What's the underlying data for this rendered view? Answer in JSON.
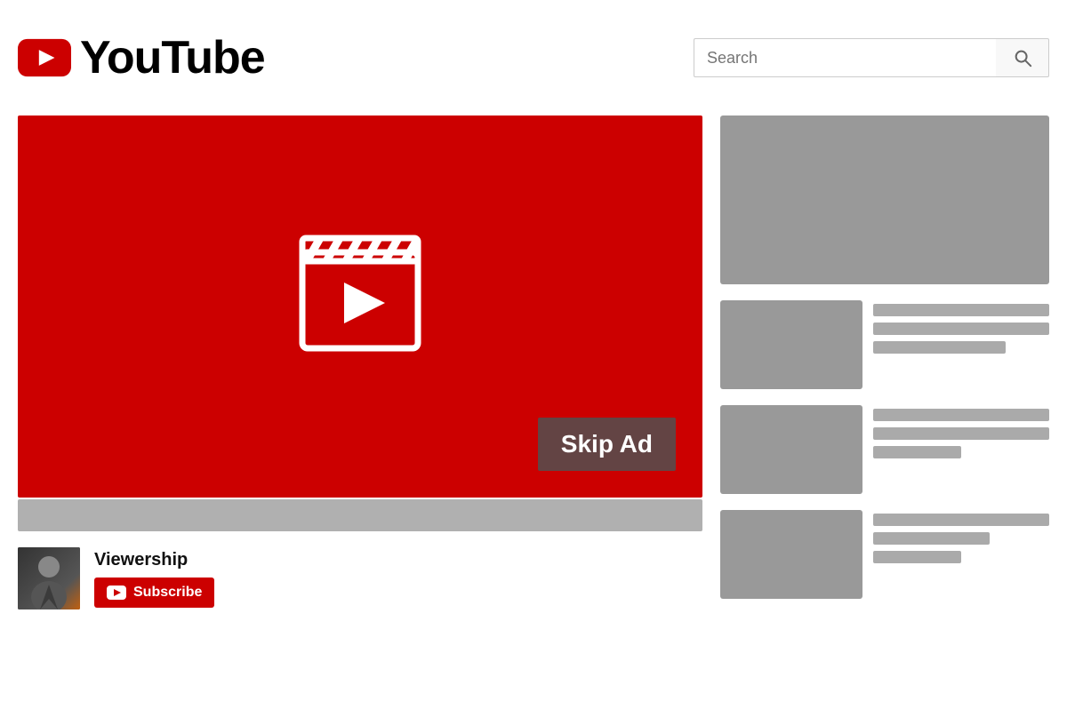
{
  "header": {
    "logo_text": "YouTube",
    "search_placeholder": "Search",
    "search_button_label": "Search"
  },
  "video": {
    "skip_ad_label": "Skip Ad",
    "channel_name": "Viewership",
    "subscribe_label": "Subscribe"
  },
  "sidebar": {
    "items": [
      {
        "id": 1
      },
      {
        "id": 2
      },
      {
        "id": 3
      }
    ]
  }
}
